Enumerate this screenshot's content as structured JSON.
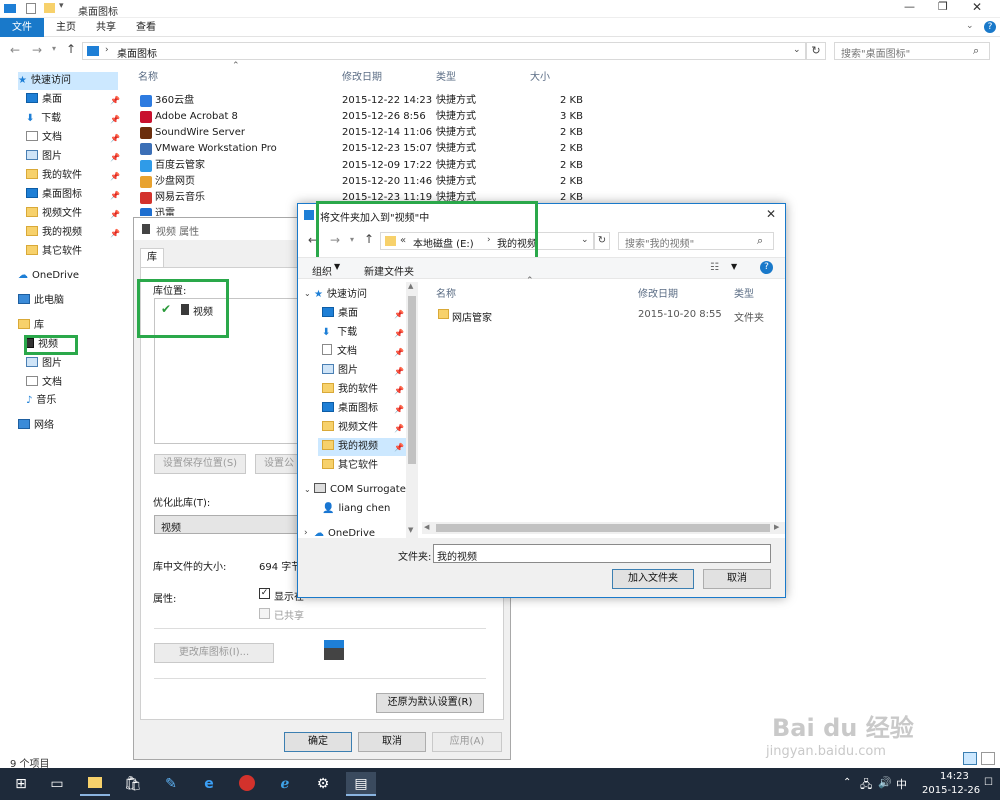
{
  "explorer": {
    "title": "桌面图标",
    "ribbon_tabs": [
      "文件",
      "主页",
      "共享",
      "查看"
    ],
    "address": "桌面图标",
    "search_placeholder": "搜索\"桌面图标\"",
    "columns": {
      "name": "名称",
      "modified": "修改日期",
      "type": "类型",
      "size": "大小"
    },
    "files": [
      {
        "name": "360云盘",
        "date": "2015-12-22 14:23",
        "type": "快捷方式",
        "size": "2 KB",
        "color": "#2d7be0"
      },
      {
        "name": "Adobe Acrobat 8",
        "date": "2015-12-26 8:56",
        "type": "快捷方式",
        "size": "3 KB",
        "color": "#c8102e"
      },
      {
        "name": "SoundWire Server",
        "date": "2015-12-14 11:06",
        "type": "快捷方式",
        "size": "2 KB",
        "color": "#6b2d0c"
      },
      {
        "name": "VMware Workstation Pro",
        "date": "2015-12-23 15:07",
        "type": "快捷方式",
        "size": "2 KB",
        "color": "#3b6fb6"
      },
      {
        "name": "百度云管家",
        "date": "2015-12-09 17:22",
        "type": "快捷方式",
        "size": "2 KB",
        "color": "#2f9be8"
      },
      {
        "name": "沙盘网页",
        "date": "2015-12-20 11:46",
        "type": "快捷方式",
        "size": "2 KB",
        "color": "#e8a22f"
      },
      {
        "name": "网易云音乐",
        "date": "2015-12-23 11:19",
        "type": "快捷方式",
        "size": "2 KB",
        "color": "#d3322c"
      },
      {
        "name": "迅雷",
        "date": "",
        "type": "",
        "size": "",
        "color": "#1e6fd0"
      }
    ],
    "nav": {
      "quick": "快速访问",
      "items": [
        "桌面",
        "下载",
        "文档",
        "图片",
        "我的软件",
        "桌面图标",
        "视频文件",
        "我的视频",
        "其它软件"
      ],
      "onedrive": "OneDrive",
      "thispc": "此电脑",
      "library": "库",
      "lib_items": [
        "视频",
        "图片",
        "文档",
        "音乐"
      ],
      "network": "网络"
    },
    "status": "9 个项目"
  },
  "props": {
    "title": "视频 属性",
    "tab": "库",
    "location_label": "库位置:",
    "location_item": "视频",
    "btn_save": "设置保存位置(S)",
    "btn_public": "设置公",
    "optimize_label": "优化此库(T):",
    "optimize_value": "视频",
    "size_label": "库中文件的大小:",
    "size_value": "694 字节",
    "attr_label": "属性:",
    "chk_show": "显示在",
    "chk_shared": "已共享",
    "btn_icon": "更改库图标(I)...",
    "btn_restore": "还原为默认设置(R)",
    "btn_ok": "确定",
    "btn_cancel": "取消",
    "btn_apply": "应用(A)"
  },
  "dialog": {
    "title": "将文件夹加入到\"视频\"中",
    "path_prefix": "«",
    "path_drive": "本地磁盘 (E:)",
    "path_folder": "我的视频",
    "search_placeholder": "搜索\"我的视频\"",
    "organize": "组织",
    "new_folder": "新建文件夹",
    "columns": {
      "name": "名称",
      "modified": "修改日期",
      "type": "类型"
    },
    "files": [
      {
        "name": "网店管家",
        "date": "2015-10-20 8:55",
        "type": "文件夹"
      }
    ],
    "nav_quick": "快速访问",
    "nav_items": [
      "桌面",
      "下载",
      "文档",
      "图片",
      "我的软件",
      "桌面图标",
      "视频文件",
      "我的视频",
      "其它软件"
    ],
    "nav_com": "COM Surrogate",
    "nav_user": "liang chen",
    "nav_onedrive": "OneDrive",
    "folder_label": "文件夹:",
    "folder_value": "我的视频",
    "btn_add": "加入文件夹",
    "btn_cancel": "取消"
  },
  "taskbar": {
    "time": "14:23",
    "date": "2015-12-26",
    "ime": "中"
  },
  "watermark": {
    "brand": "Bai du 经验",
    "url": "jingyan.baidu.com"
  }
}
